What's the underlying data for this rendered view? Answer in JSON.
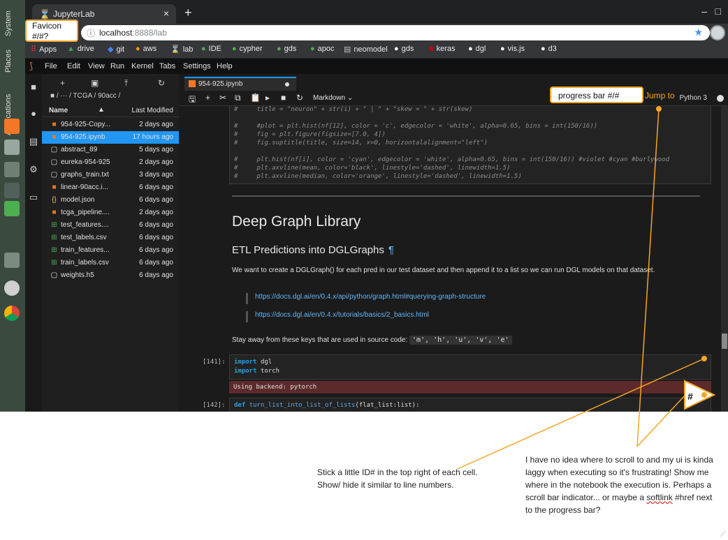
{
  "desktop": {
    "menu_labels": [
      "Applications",
      "Places",
      "System"
    ]
  },
  "browser": {
    "tab_title": "JupyterLab",
    "url_host": "localhost",
    "url_path": ":8888/lab",
    "bookmarks": [
      "Apps",
      "drive",
      "git",
      "aws",
      "lab",
      "IDE",
      "cypher",
      "gds",
      "apoc",
      "neomodel",
      "gds",
      "keras",
      "dgl",
      "vis.js",
      "d3"
    ]
  },
  "jupyter": {
    "menu": [
      "File",
      "Edit",
      "View",
      "Run",
      "Kernel",
      "Tabs",
      "Settings",
      "Help"
    ],
    "breadcrumb": "/ ··· / TCGA / 90acc /",
    "file_header": {
      "name": "Name",
      "modified": "Last Modified"
    },
    "files": [
      {
        "name": "954-925-Copy...",
        "modified": "2 days ago",
        "icon": "notebook"
      },
      {
        "name": "954-925.ipynb",
        "modified": "17 hours ago",
        "icon": "notebook"
      },
      {
        "name": "abstract_89",
        "modified": "5 days ago",
        "icon": "file"
      },
      {
        "name": "eureka-954-925",
        "modified": "2 days ago",
        "icon": "file"
      },
      {
        "name": "graphs_train.txt",
        "modified": "3 days ago",
        "icon": "file"
      },
      {
        "name": "linear-90acc.i...",
        "modified": "6 days ago",
        "icon": "notebook"
      },
      {
        "name": "model.json",
        "modified": "6 days ago",
        "icon": "json"
      },
      {
        "name": "tcga_pipeline....",
        "modified": "2 days ago",
        "icon": "notebook"
      },
      {
        "name": "test_features....",
        "modified": "6 days ago",
        "icon": "csv"
      },
      {
        "name": "test_labels.csv",
        "modified": "6 days ago",
        "icon": "csv"
      },
      {
        "name": "train_features...",
        "modified": "6 days ago",
        "icon": "csv"
      },
      {
        "name": "train_labels.csv",
        "modified": "6 days ago",
        "icon": "csv"
      },
      {
        "name": "weights.h5",
        "modified": "6 days ago",
        "icon": "file"
      }
    ],
    "doc_tab": "954-925.ipynb",
    "cell_type": "Markdown",
    "kernel": "Python 3",
    "code_lines": [
      "#     title = \"neuron\" + str(i) + \" | \" + \"skew = \" + str(skew)",
      "",
      "#     #plot = plt.hist(nf[12], color = 'c', edgecolor = 'white', alpha=0.65, bins = int(150/16))",
      "#     fig = plt.figure(figsize=[7.0, 4])",
      "#     fig.suptitle(title, size=14, x=0, horizontalalignment=\"left\")",
      "",
      "#     plt.hist(nf[i], color = 'cyan', edgecolor = 'white', alpha=0.65, bins = int(150/16)) #violet #cyan #burlywood",
      "#     plt.axvline(mean, color='black', linestyle='dashed', linewidth=1.5)",
      "#     plt.axvline(median, color='orange', linestyle='dashed', linewidth=1.5)"
    ],
    "h1": "Deep Graph Library",
    "h2": "ETL Predictions into DGLGraphs",
    "pilcrow": "¶",
    "para": "We want to create a DGLGraph() for each pred in our test dataset and then append it to a list so we can run DGL models on that dataset.",
    "links": [
      "https://docs.dgl.ai/en/0.4.x/api/python/graph.html#querying-graph-structure",
      "https://docs.dgl.ai/en/0.4.x/tutorials/basics/2_basics.html"
    ],
    "para2": "Stay away from these keys that are used in source code:",
    "para2_code": "'m', 'h', 'u', 'v', 'e'",
    "cell141": {
      "prompt": "[141]:",
      "lines": [
        "dgl",
        "torch"
      ],
      "kw": "import",
      "output": "Using backend: pytorch"
    },
    "cell142": {
      "prompt": "[142]:",
      "kw": "def",
      "fn": "turn_list_into_list_of_lists",
      "rest": "(flat_list:list):"
    }
  },
  "annotations": {
    "favicon": "Favicon\n#/#?",
    "progress": "progress bar #/#",
    "jump_to": "Jump to",
    "hash": "#",
    "note_left": "Stick a little ID# in the top right of each cell. Show/ hide it similar to line numbers.",
    "note_right_a": "I have no idea where to scroll to and my ui is kinda laggy when executing so it's frustrating! Show me where in the notebook the execution is. Perhaps a scroll bar indicator... or maybe a ",
    "note_right_b": "softlink",
    "note_right_c": " #href next to the progress bar?",
    "accent": "#f5a623"
  }
}
